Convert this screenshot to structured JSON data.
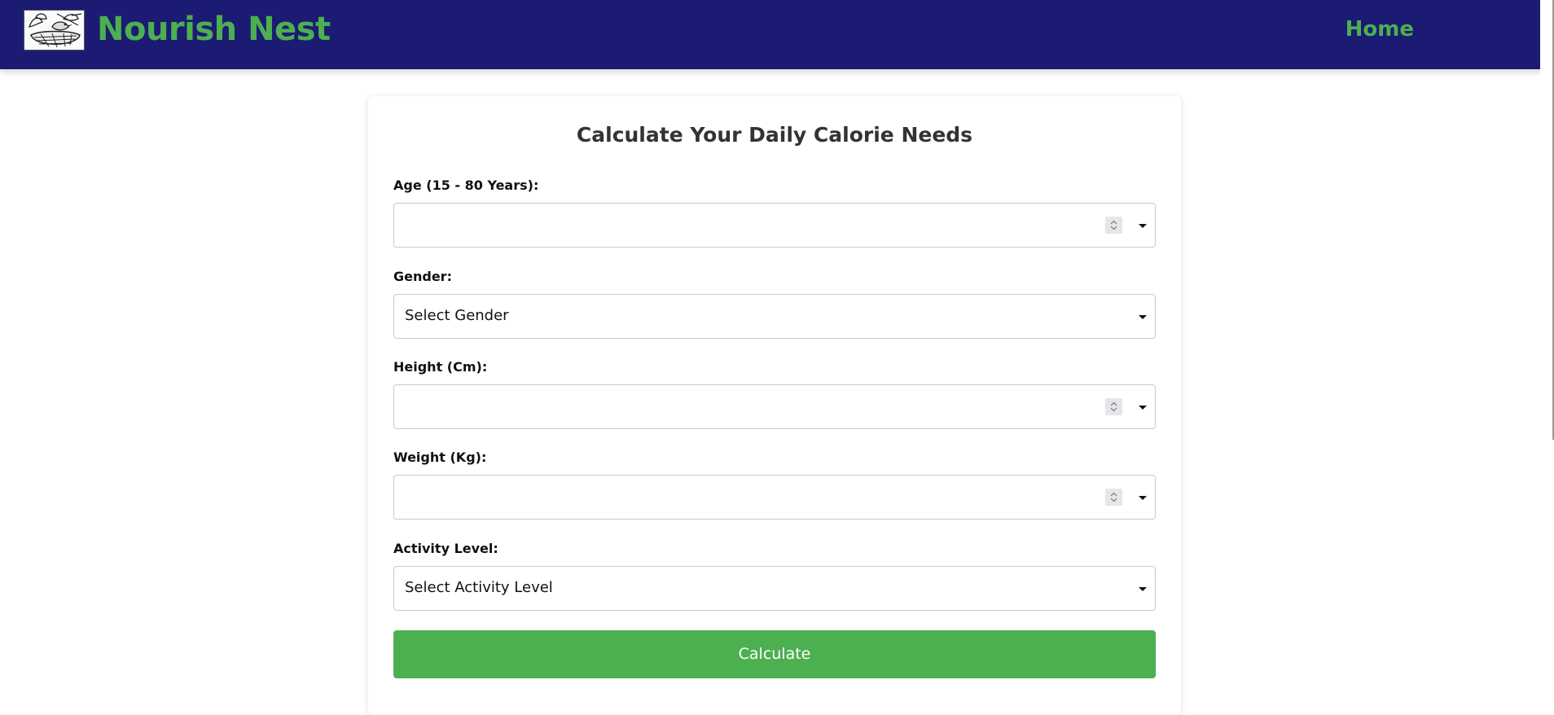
{
  "header": {
    "brand": "Nourish Nest",
    "nav_home": "Home",
    "logo_icon": "bird-nest-logo-icon"
  },
  "colors": {
    "navbar": "#1b1b73",
    "accent": "#4caf50",
    "title_text": "#333333"
  },
  "form": {
    "title": "Calculate Your Daily Calorie Needs",
    "age": {
      "label": "Age (15 - 80 Years):",
      "value": ""
    },
    "gender": {
      "label": "Gender:",
      "selected": "Select Gender"
    },
    "height": {
      "label": "Height (Cm):",
      "value": ""
    },
    "weight": {
      "label": "Weight (Kg):",
      "value": ""
    },
    "activity": {
      "label": "Activity Level:",
      "selected": "Select Activity Level"
    },
    "submit_label": "Calculate"
  }
}
